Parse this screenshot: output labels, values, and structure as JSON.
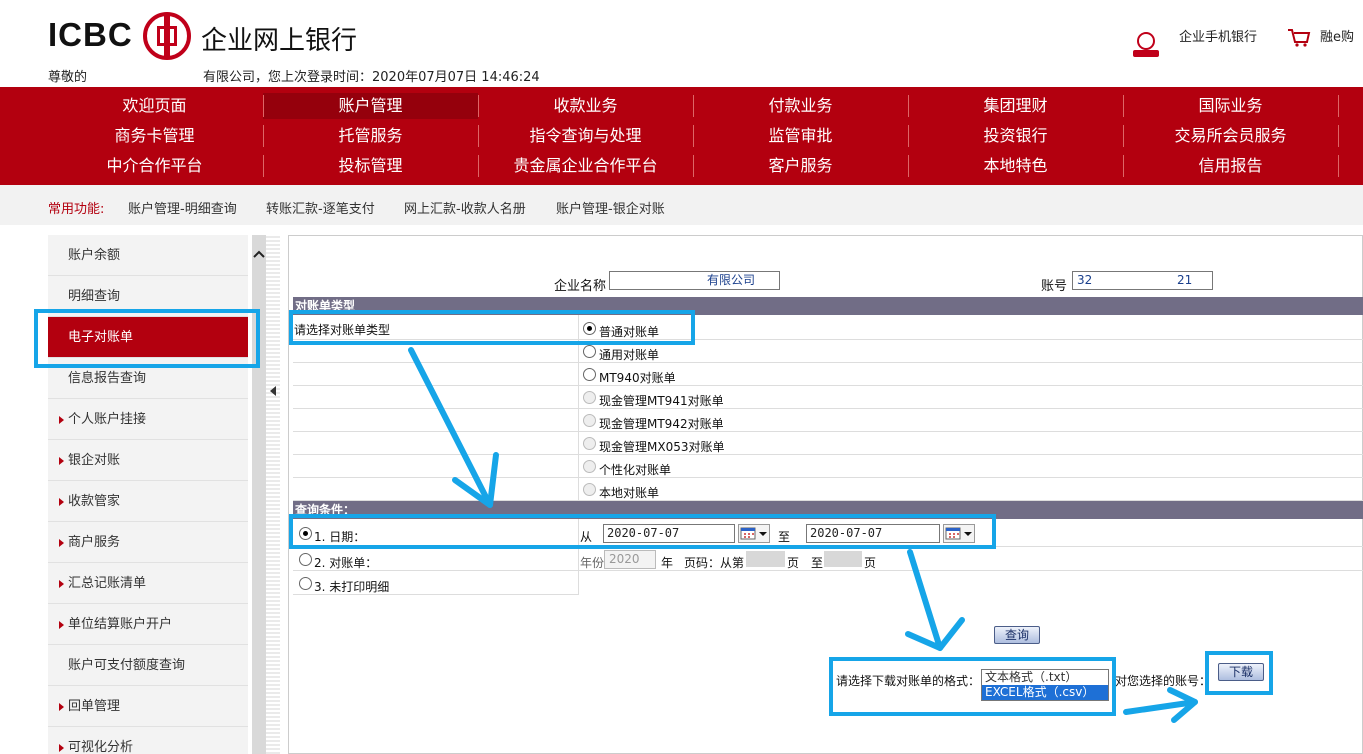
{
  "header": {
    "logo_text": "ICBC",
    "bank_name": "企业网上银行",
    "greeting": "尊敬的",
    "login_info": "有限公司，您上次登录时间：2020年07月07日 14:46:24",
    "mobile_bank": "企业手机银行",
    "rongegou": "融e购"
  },
  "nav": {
    "rows": [
      [
        "欢迎页面",
        "账户管理",
        "收款业务",
        "付款业务",
        "集团理财",
        "国际业务"
      ],
      [
        "商务卡管理",
        "托管服务",
        "指令查询与处理",
        "监管审批",
        "投资银行",
        "交易所会员服务"
      ],
      [
        "中介合作平台",
        "投标管理",
        "贵金属企业合作平台",
        "客户服务",
        "本地特色",
        "信用报告"
      ]
    ],
    "active": "账户管理"
  },
  "common": {
    "label": "常用功能:",
    "links": [
      "账户管理-明细查询",
      "转账汇款-逐笔支付",
      "网上汇款-收款人名册",
      "账户管理-银企对账"
    ]
  },
  "sidebar": {
    "items": [
      {
        "label": "账户余额",
        "arrow": false,
        "active": false
      },
      {
        "label": "明细查询",
        "arrow": false,
        "active": false
      },
      {
        "label": "电子对账单",
        "arrow": false,
        "active": true
      },
      {
        "label": "信息报告查询",
        "arrow": false,
        "active": false
      },
      {
        "label": "个人账户挂接",
        "arrow": true,
        "active": false
      },
      {
        "label": "银企对账",
        "arrow": true,
        "active": false
      },
      {
        "label": "收款管家",
        "arrow": true,
        "active": false
      },
      {
        "label": "商户服务",
        "arrow": true,
        "active": false
      },
      {
        "label": "汇总记账清单",
        "arrow": true,
        "active": false
      },
      {
        "label": "单位结算账户开户",
        "arrow": true,
        "active": false
      },
      {
        "label": "账户可支付额度查询",
        "arrow": false,
        "active": false
      },
      {
        "label": "回单管理",
        "arrow": true,
        "active": false
      },
      {
        "label": "可视化分析",
        "arrow": true,
        "active": false
      }
    ]
  },
  "form": {
    "company_label": "企业名称",
    "company_value": "有限公司",
    "account_label": "账号",
    "account_value_start": "32",
    "account_value_end": "21",
    "section1": "对账单类型",
    "choose_label": "请选择对账单类型",
    "types": [
      {
        "label": "普通对账单",
        "state": "on"
      },
      {
        "label": "通用对账单",
        "state": "off"
      },
      {
        "label": "MT940对账单",
        "state": "off"
      },
      {
        "label": "现金管理MT941对账单",
        "state": "disabled"
      },
      {
        "label": "现金管理MT942对账单",
        "state": "disabled"
      },
      {
        "label": "现金管理MX053对账单",
        "state": "disabled"
      },
      {
        "label": "个性化对账单",
        "state": "disabled"
      },
      {
        "label": "本地对账单",
        "state": "disabled"
      }
    ],
    "section2": "查询条件：",
    "cond1": "1. 日期：",
    "from": "从",
    "to": "至",
    "date_from": "2020-07-07",
    "date_to": "2020-07-07",
    "cond2": "2. 对账单：",
    "year_label": "年份",
    "year_value": "2020",
    "year_suffix": "年",
    "page_from": "页码：从第",
    "page_unit": "页",
    "page_to": "至",
    "page_unit2": "页",
    "cond3": "3. 未打印明细",
    "query_btn": "查询",
    "format_label": "请选择下载对账单的格式：",
    "formats": [
      "文本格式（.txt）",
      "EXCEL格式（.csv）"
    ],
    "selected_format": "EXCEL格式（.csv）",
    "account_suffix": "对您选择的账号：",
    "download_btn": "下载"
  },
  "colors": {
    "brand_red": "#b3000f",
    "highlight_blue": "#16a5e8",
    "section_bar": "#716d86"
  }
}
